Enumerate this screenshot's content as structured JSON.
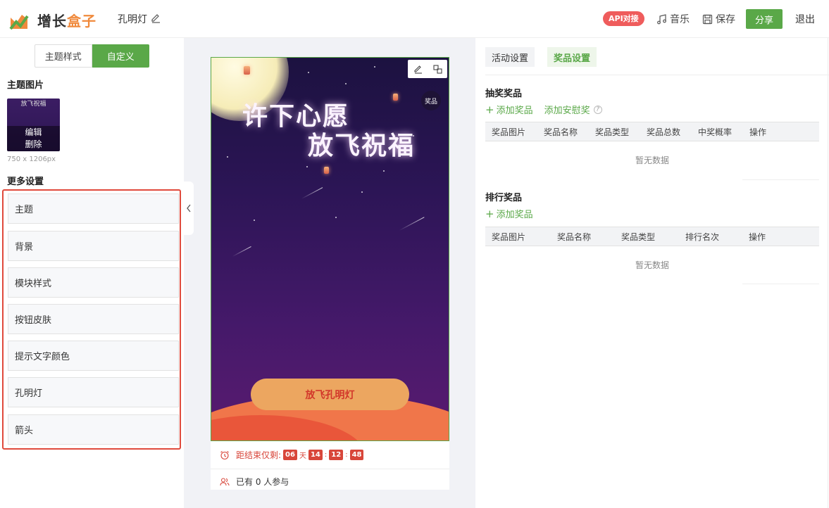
{
  "header": {
    "brand_main": "增长",
    "brand_accent": "盒子",
    "page_name": "孔明灯",
    "api_badge": "API对接",
    "music": "音乐",
    "save": "保存",
    "share": "分享",
    "logout": "退出"
  },
  "left": {
    "tab_theme": "主题样式",
    "tab_custom": "自定义",
    "theme_image_title": "主题图片",
    "thumb_caption": "放飞祝福",
    "thumb_edit": "编辑",
    "thumb_delete": "删除",
    "thumb_size": "750 x 1206px",
    "more_title": "更多设置",
    "items": [
      "主题",
      "背景",
      "模块样式",
      "按钮皮肤",
      "提示文字颜色",
      "孔明灯",
      "箭头"
    ]
  },
  "poster": {
    "headline1": "许下心愿",
    "headline2": "放飞祝福",
    "prize_tag": "奖品",
    "cta": "放飞孔明灯",
    "countdown_label": "距结束仅剩:",
    "days": "06",
    "day_unit": "天",
    "hours": "14",
    "minutes": "12",
    "seconds": "48",
    "sep": ":",
    "participants": "已有 0 人参与"
  },
  "right": {
    "tab_activity": "活动设置",
    "tab_prize": "奖品设置",
    "draw_title": "抽奖奖品",
    "add_prize": "添加奖品",
    "add_consolation": "添加安慰奖",
    "draw_cols": [
      "奖品图片",
      "奖品名称",
      "奖品类型",
      "奖品总数",
      "中奖概率",
      "操作"
    ],
    "empty": "暂无数据",
    "rank_title": "排行奖品",
    "rank_add": "添加奖品",
    "rank_cols": [
      "奖品图片",
      "奖品名称",
      "奖品类型",
      "排行名次",
      "操作"
    ]
  },
  "colors": {
    "accent_green": "#5aa848",
    "brand_orange": "#f08a3c",
    "highlight_red": "#e04a3c"
  }
}
